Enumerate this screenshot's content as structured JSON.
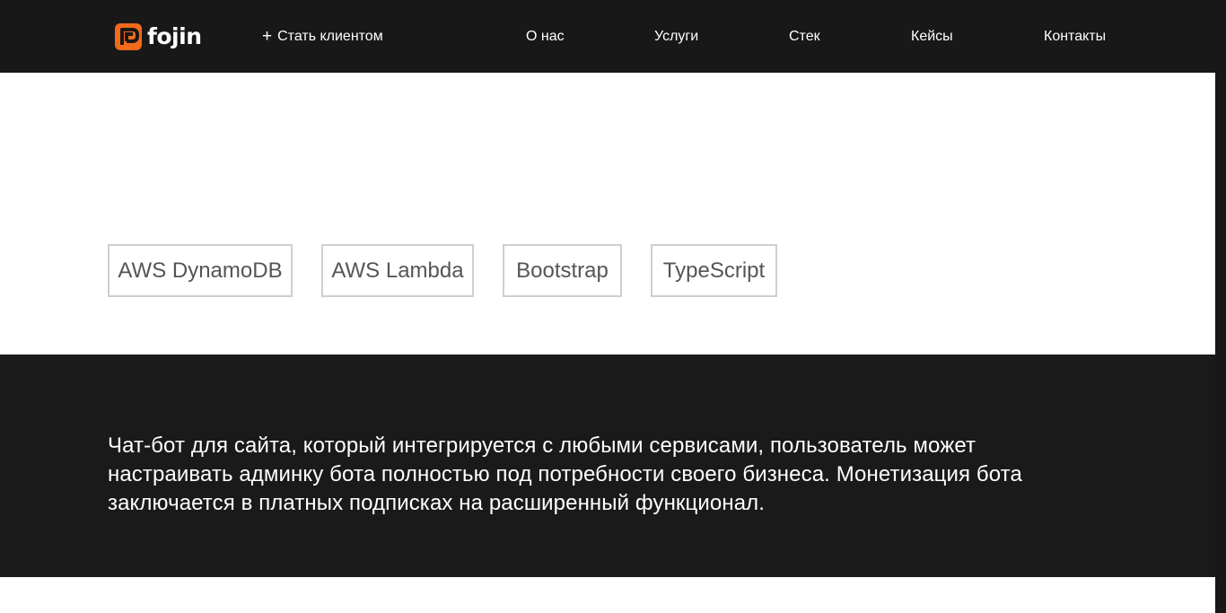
{
  "header": {
    "logo_text": "fojin",
    "cta_label": "Стать клиентом",
    "cta_icon": "plus-icon",
    "nav": [
      {
        "label": "О нас"
      },
      {
        "label": "Услуги"
      },
      {
        "label": "Стек"
      },
      {
        "label": "Кейсы"
      },
      {
        "label": "Контакты"
      }
    ]
  },
  "stack": {
    "tags": [
      {
        "label": "AWS DynamoDB"
      },
      {
        "label": "AWS Lambda"
      },
      {
        "label": "Bootstrap"
      },
      {
        "label": "TypeScript"
      }
    ]
  },
  "description": {
    "text": "Чат-бот для сайта, который интегрируется с любыми сервисами, пользователь может настраивать админку бота полностью под потребности своего бизнеса. Монетизация бота заключается в платных подписках на расширенный функционал."
  },
  "colors": {
    "brand_orange": "#f26a1b",
    "header_bg": "#181818",
    "dark_section_bg": "#1a1a1a",
    "tag_border": "#cfcfcf",
    "tag_text": "#555555"
  }
}
